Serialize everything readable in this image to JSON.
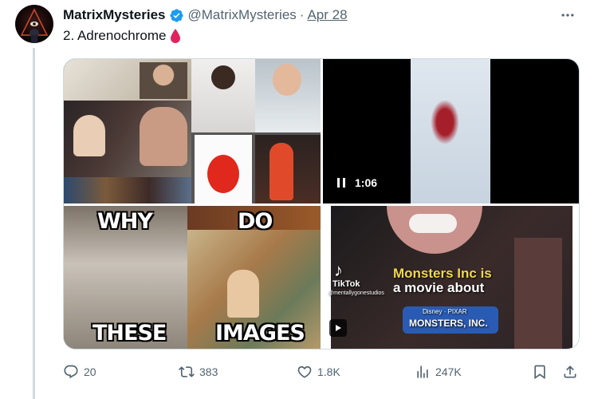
{
  "author": {
    "display_name": "MatrixMysteries",
    "handle": "@MatrixMysteries",
    "date": "Apr 28",
    "verified": true
  },
  "tweet": {
    "text": "2. Adrenochrome"
  },
  "media": {
    "video_duration": "1:06",
    "meme_words": [
      "WHY",
      "DO",
      "THESE",
      "IMAGES"
    ],
    "tiktok": {
      "brand": "TikTok",
      "username": "@mentallygonestudios",
      "caption_line1": "Monsters Inc is",
      "caption_line2": "a movie about",
      "logo_top": "Disney · PIXAR",
      "logo_main": "MONSTERS, INC."
    }
  },
  "actions": {
    "replies": "20",
    "reposts": "383",
    "likes": "1.8K",
    "views": "247K"
  },
  "icons": [
    "verified-badge-icon",
    "blood-drop-icon",
    "more-icon",
    "reply-icon",
    "repost-icon",
    "like-icon",
    "views-icon",
    "bookmark-icon",
    "share-icon",
    "pause-icon",
    "play-icon"
  ],
  "colors": {
    "text": "#0f1419",
    "secondary": "#536471",
    "verified": "#1d9bf0",
    "drop": "#e0245e"
  }
}
